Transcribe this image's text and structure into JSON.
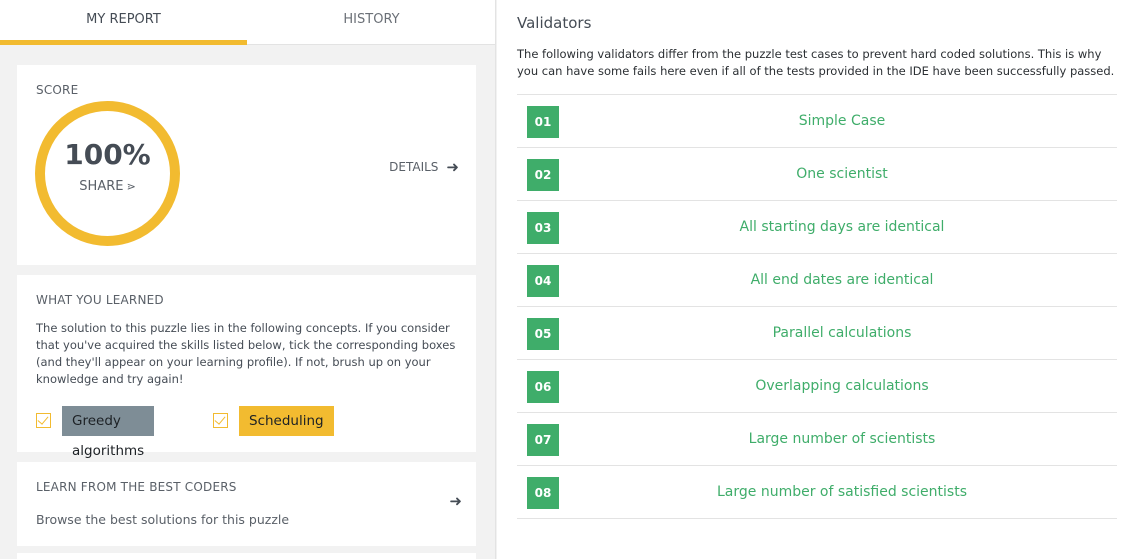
{
  "tabs": {
    "report": "MY REPORT",
    "history": "HISTORY"
  },
  "score": {
    "label": "SCORE",
    "percent": "100%",
    "share": "SHARE",
    "details": "DETAILS",
    "fraction": 1.0
  },
  "learned": {
    "label": "WHAT YOU LEARNED",
    "text": "The solution to this puzzle lies in the following concepts. If you consider that you've acquired the skills listed below, tick the corresponding boxes (and they'll appear on your learning profile). If not, brush up on your knowledge and try again!",
    "skills": [
      {
        "name": "Greedy algorithms",
        "checked": true
      },
      {
        "name": "Scheduling",
        "checked": true
      }
    ]
  },
  "best": {
    "label": "LEARN FROM THE BEST CODERS",
    "subtitle": "Browse the best solutions for this puzzle"
  },
  "validators": {
    "title": "Validators",
    "description": "The following validators differ from the puzzle test cases to prevent hard coded solutions. This is why you can have some fails here even if all of the tests provided in the IDE have been successfully passed.",
    "items": [
      {
        "num": "01",
        "name": "Simple Case"
      },
      {
        "num": "02",
        "name": "One scientist"
      },
      {
        "num": "03",
        "name": "All starting days are identical"
      },
      {
        "num": "04",
        "name": "All end dates are identical"
      },
      {
        "num": "05",
        "name": "Parallel calculations"
      },
      {
        "num": "06",
        "name": "Overlapping calculations"
      },
      {
        "num": "07",
        "name": "Large number of scientists"
      },
      {
        "num": "08",
        "name": "Large number of satisfied scientists"
      }
    ]
  },
  "colors": {
    "accent_yellow": "#f2bb30",
    "success_green": "#3fad6a",
    "chip_grey": "#7e8d96"
  }
}
